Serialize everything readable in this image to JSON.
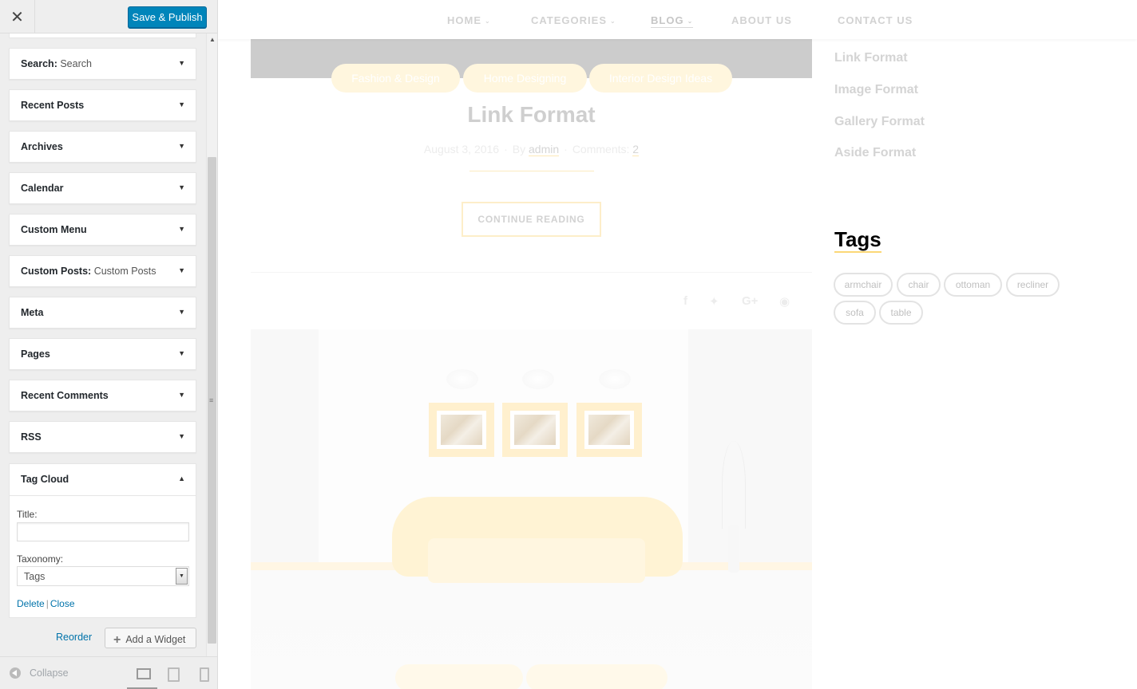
{
  "customizer": {
    "close_glyph": "✕",
    "save_button": "Save & Publish",
    "widgets": [
      {
        "title": "Search:",
        "subtitle": "Search"
      },
      {
        "title": "Recent Posts",
        "subtitle": ""
      },
      {
        "title": "Archives",
        "subtitle": ""
      },
      {
        "title": "Calendar",
        "subtitle": ""
      },
      {
        "title": "Custom Menu",
        "subtitle": ""
      },
      {
        "title": "Custom Posts:",
        "subtitle": "Custom Posts"
      },
      {
        "title": "Meta",
        "subtitle": ""
      },
      {
        "title": "Pages",
        "subtitle": ""
      },
      {
        "title": "Recent Comments",
        "subtitle": ""
      },
      {
        "title": "RSS",
        "subtitle": ""
      }
    ],
    "tag_cloud": {
      "title": "Tag Cloud",
      "title_label": "Title:",
      "title_value": "",
      "taxonomy_label": "Taxonomy:",
      "taxonomy_value": "Tags",
      "delete_link": "Delete",
      "separator": "|",
      "close_link": "Close"
    },
    "reorder": "Reorder",
    "add_widget": "Add a Widget",
    "collapse": "Collapse",
    "icons": {
      "close": "close-icon",
      "expand_arrow": "triangle-down-icon",
      "collapse_arrow": "triangle-up-icon",
      "plus": "plus-icon",
      "collapse": "collapse-circle-icon",
      "desktop": "desktop-icon",
      "tablet": "tablet-icon",
      "mobile": "mobile-icon"
    },
    "accent_color": "#0085ba"
  },
  "site": {
    "nav": [
      {
        "label": "HOME",
        "has_dropdown": true
      },
      {
        "label": "CATEGORIES",
        "has_dropdown": true
      },
      {
        "label": "BLOG",
        "has_dropdown": true
      },
      {
        "label": "ABOUT US",
        "has_dropdown": false
      },
      {
        "label": "CONTACT US",
        "has_dropdown": false
      }
    ],
    "post": {
      "categories": [
        "Fashion & Design",
        "Home Designing",
        "Interior Design Ideas"
      ],
      "title": "Link Format",
      "date": "August 3, 2016",
      "by_label": "By",
      "author": "admin",
      "comments_label": "Comments:",
      "comments_count": "2",
      "continue_button": "CONTINUE READING",
      "share_icons": [
        "facebook-icon",
        "twitter-icon",
        "google-plus-icon",
        "pinterest-icon"
      ]
    },
    "sidebar": {
      "recent_posts": [
        "Link Format",
        "Image Format",
        "Gallery Format",
        "Aside Format"
      ],
      "tags_heading": "Tags",
      "tags": [
        "armchair",
        "chair",
        "ottoman",
        "recliner",
        "sofa",
        "table"
      ]
    },
    "accent_color": "#fcd877"
  }
}
